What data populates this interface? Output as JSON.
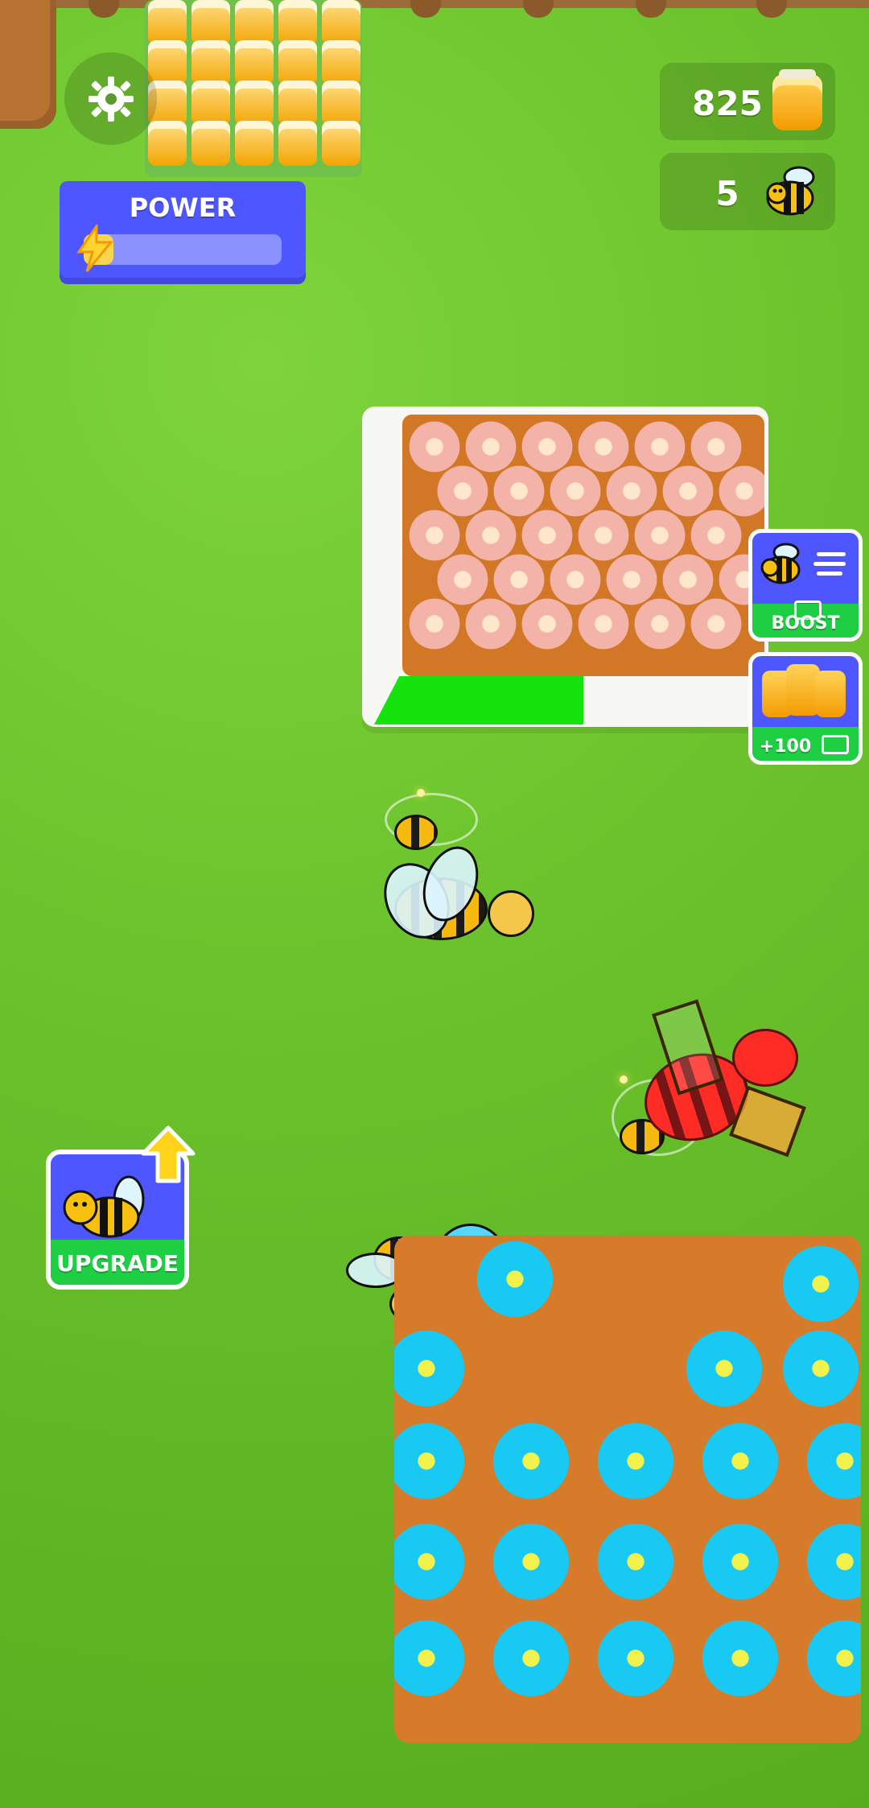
{
  "hud": {
    "honey_count": "825",
    "bee_count": "5",
    "power_label": "POWER",
    "power_level_percent": 15
  },
  "buttons": {
    "boost_label": "BOOST",
    "honey_bonus_label": "+100",
    "upgrade_label": "UPGRADE"
  },
  "icons": {
    "settings": "gear-icon",
    "honey_jar": "honey-jar-icon",
    "bee": "bee-icon",
    "power": "lightning-bolt-icon",
    "video": "video-ad-icon",
    "upgrade_arrow": "up-arrow-icon"
  },
  "colors": {
    "panel_blue": "#4e57ff",
    "button_green": "#1fcf43",
    "grass": "#6cc22c",
    "field_soil": "#d17725",
    "progress_green": "#15e30d",
    "blue_flower": "#18c9f3",
    "red_bee": "#ff2b25"
  }
}
